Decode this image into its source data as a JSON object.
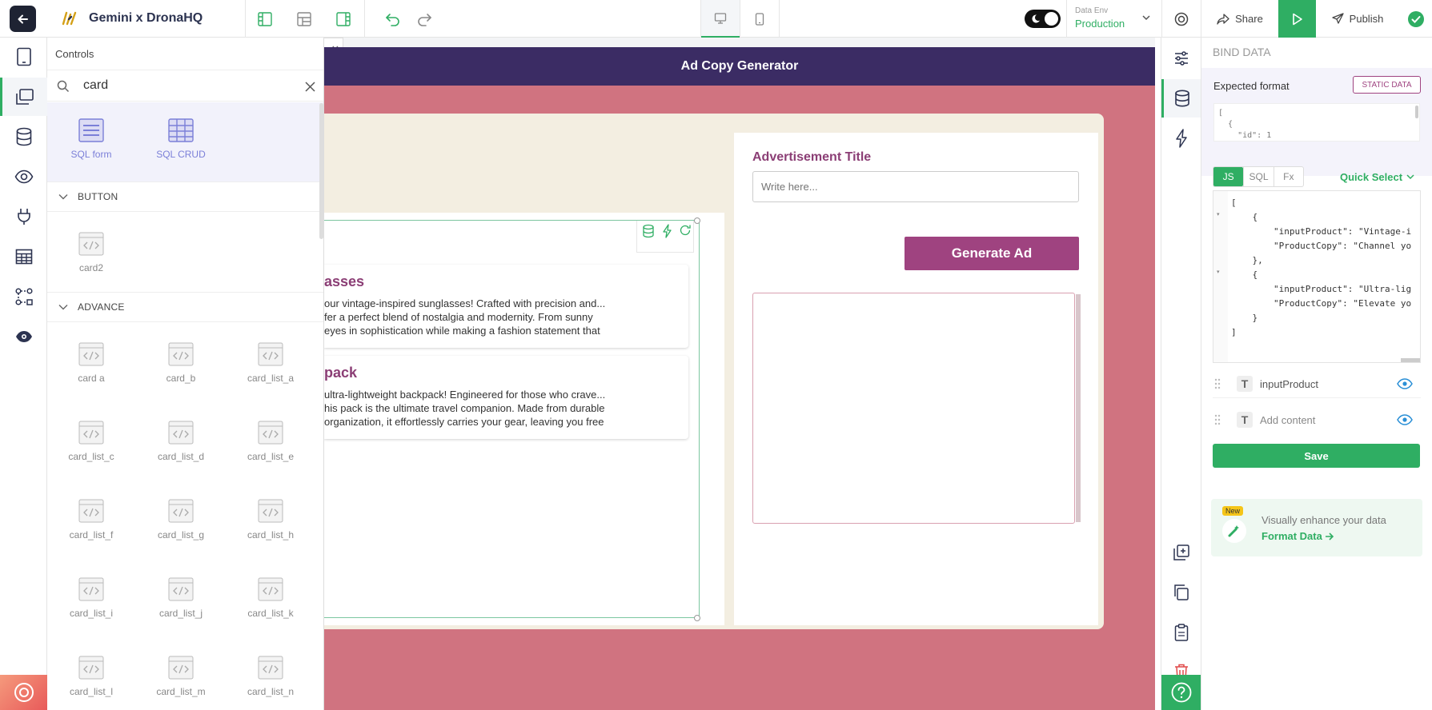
{
  "app": {
    "title": "Gemini x DronaHQ",
    "data_env_label": "Data Env",
    "data_env_value": "Production",
    "share_label": "Share",
    "publish_label": "Publish"
  },
  "controls": {
    "header": "Controls",
    "search_value": "card",
    "top_results": [
      {
        "label": "SQL form"
      },
      {
        "label": "SQL CRUD"
      }
    ],
    "sections": [
      {
        "title": "BUTTON",
        "items": [
          "card2"
        ]
      },
      {
        "title": "ADVANCE",
        "items": [
          "card a",
          "card_b",
          "card_list_a",
          "card_list_c",
          "card_list_d",
          "card_list_e",
          "card_list_f",
          "card_list_g",
          "card_list_h",
          "card_list_i",
          "card_list_j",
          "card_list_k",
          "card_list_l",
          "card_list_m",
          "card_list_n"
        ]
      }
    ]
  },
  "screen": {
    "title": "Ad Copy Generator",
    "cards": [
      {
        "title": "asses",
        "lines": [
          "our vintage-inspired sunglasses! Crafted with precision and...",
          "fer a perfect blend of nostalgia and modernity. From sunny",
          "eyes in sophistication while making a fashion statement that"
        ]
      },
      {
        "title": "pack",
        "lines": [
          "ultra-lightweight backpack! Engineered for those who crave...",
          "his pack is the ultimate travel companion. Made from durable",
          "organization, it effortlessly carries your gear, leaving you free"
        ]
      }
    ],
    "ad_title_label": "Advertisement Title",
    "ad_title_placeholder": "Write here...",
    "generate_label": "Generate Ad"
  },
  "bind": {
    "header": "BIND DATA",
    "expected_format": "Expected format",
    "static_data": "STATIC DATA",
    "format_preview": [
      "[",
      "  {",
      "    \"id\": 1"
    ],
    "tabs": [
      "JS",
      "SQL",
      "Fx"
    ],
    "quick_select": "Quick Select",
    "code_lines": [
      "[",
      "    {",
      "        \"inputProduct\": \"Vintage-i",
      "        \"ProductCopy\": \"Channel yo",
      "    },",
      "    {",
      "        \"inputProduct\": \"Ultra-lig",
      "        \"ProductCopy\": \"Elevate yo",
      "    }",
      "]"
    ],
    "fields": [
      {
        "label": "inputProduct",
        "placeholder": ""
      },
      {
        "label": "",
        "placeholder": "Add content"
      }
    ],
    "save_label": "Save",
    "promo_badge": "New",
    "promo_text": "Visually enhance your data",
    "promo_link": "Format Data"
  },
  "colors": {
    "accent": "#2fae63",
    "header_purple": "#3b2c64",
    "screen_bg": "#d07380",
    "card_bg": "#f3eee1",
    "button_purple": "#9f4380",
    "title_purple": "#8b3e75"
  }
}
